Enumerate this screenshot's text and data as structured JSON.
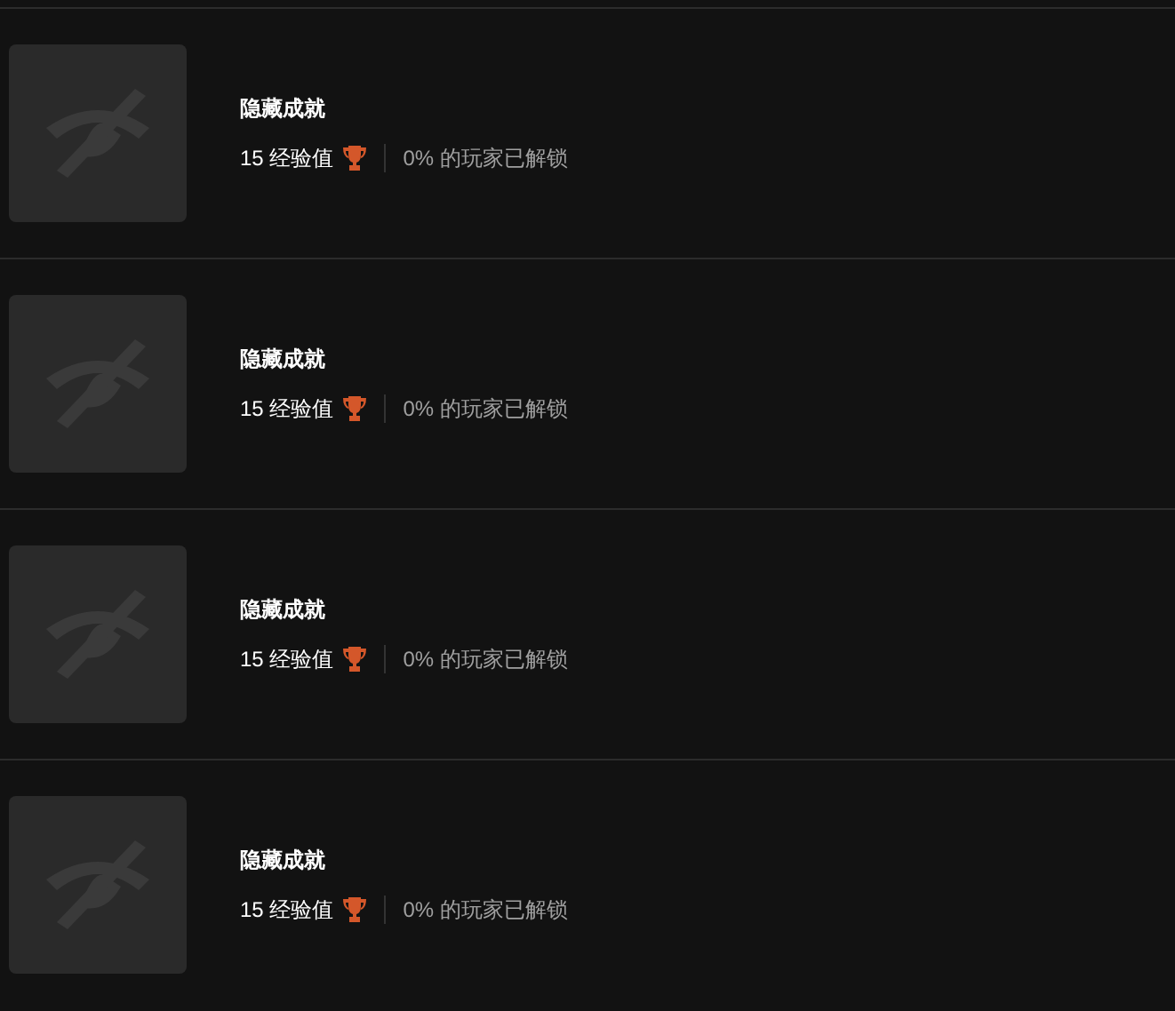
{
  "achievements": [
    {
      "title": "隐藏成就",
      "xp": "15 经验值",
      "unlocked": "0% 的玩家已解锁"
    },
    {
      "title": "隐藏成就",
      "xp": "15 经验值",
      "unlocked": "0% 的玩家已解锁"
    },
    {
      "title": "隐藏成就",
      "xp": "15 经验值",
      "unlocked": "0% 的玩家已解锁"
    },
    {
      "title": "隐藏成就",
      "xp": "15 经验值",
      "unlocked": "0% 的玩家已解锁"
    }
  ]
}
